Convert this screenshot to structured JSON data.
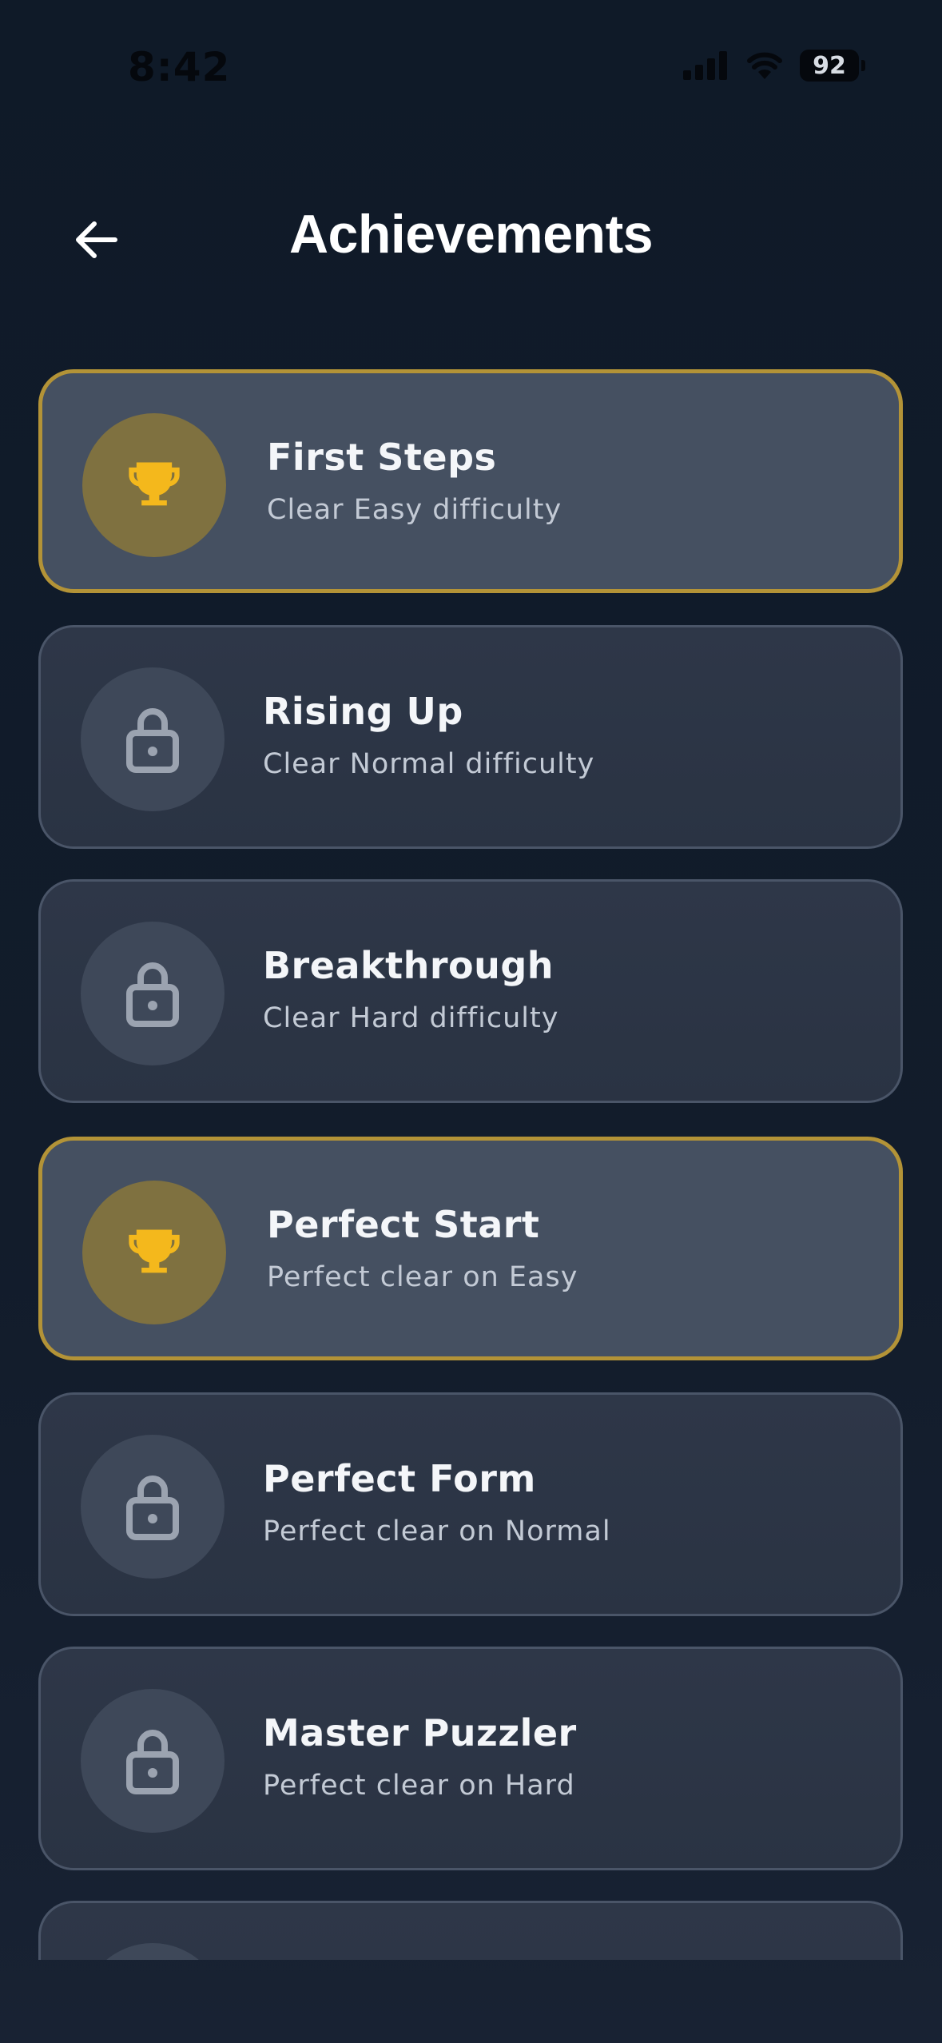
{
  "status_bar": {
    "time": "8:42",
    "battery_level": "92",
    "icons": [
      "signal-icon",
      "wifi-icon",
      "battery-icon"
    ]
  },
  "header": {
    "title": "Achievements",
    "back_icon": "arrow-left-icon"
  },
  "colors": {
    "background": "#111a28",
    "card_locked": "#2c3545",
    "card_unlocked": "#455061",
    "gold_border": "#b39337",
    "trophy": "#f4b81c",
    "lock_icon": "#9ba3b0"
  },
  "achievements": [
    {
      "title": "First Steps",
      "description": "Clear Easy difficulty",
      "unlocked": true,
      "icon": "trophy-icon"
    },
    {
      "title": "Rising Up",
      "description": "Clear Normal difficulty",
      "unlocked": false,
      "icon": "lock-icon"
    },
    {
      "title": "Breakthrough",
      "description": "Clear Hard difficulty",
      "unlocked": false,
      "icon": "lock-icon"
    },
    {
      "title": "Perfect Start",
      "description": "Perfect clear on Easy",
      "unlocked": true,
      "icon": "trophy-icon"
    },
    {
      "title": "Perfect Form",
      "description": "Perfect clear on Normal",
      "unlocked": false,
      "icon": "lock-icon"
    },
    {
      "title": "Master Puzzler",
      "description": "Perfect clear on Hard",
      "unlocked": false,
      "icon": "lock-icon"
    },
    {
      "title": "",
      "description": "",
      "unlocked": false,
      "icon": "lock-icon"
    }
  ]
}
